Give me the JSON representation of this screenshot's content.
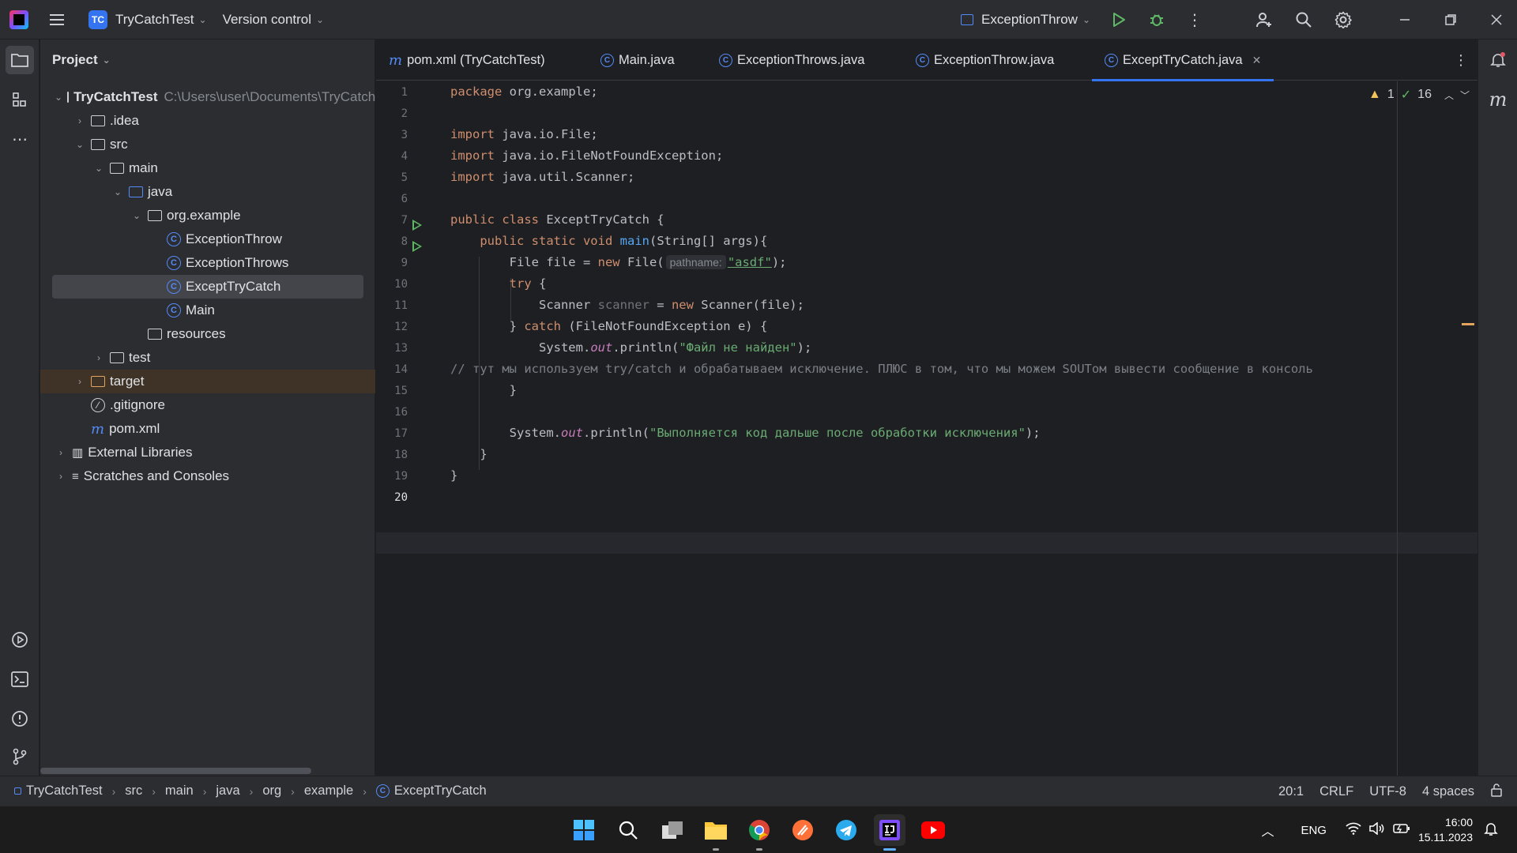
{
  "titlebar": {
    "project_badge": "TC",
    "project_name": "TryCatchTest",
    "vcs_label": "Version control",
    "run_config": "ExceptionThrow"
  },
  "project_panel": {
    "title": "Project",
    "root_name": "TryCatchTest",
    "root_path": "C:\\Users\\user\\Documents\\TryCatchTest",
    "items": [
      {
        "label": "TryCatchTest"
      },
      {
        "label": ".idea"
      },
      {
        "label": "src"
      },
      {
        "label": "main"
      },
      {
        "label": "java"
      },
      {
        "label": "org.example"
      },
      {
        "label": "ExceptionThrow"
      },
      {
        "label": "ExceptionThrows"
      },
      {
        "label": "ExceptTryCatch"
      },
      {
        "label": "Main"
      },
      {
        "label": "resources"
      },
      {
        "label": "test"
      },
      {
        "label": "target"
      },
      {
        "label": ".gitignore"
      },
      {
        "label": "pom.xml"
      },
      {
        "label": "External Libraries"
      },
      {
        "label": "Scratches and Consoles"
      }
    ]
  },
  "tabs": [
    {
      "label": "pom.xml (TryCatchTest)"
    },
    {
      "label": "Main.java"
    },
    {
      "label": "ExceptionThrows.java"
    },
    {
      "label": "ExceptionThrow.java"
    },
    {
      "label": "ExceptTryCatch.java"
    }
  ],
  "inspections": {
    "warnings": "1",
    "checks": "16"
  },
  "code": {
    "line_numbers": [
      "1",
      "2",
      "3",
      "4",
      "5",
      "6",
      "7",
      "8",
      "9",
      "10",
      "11",
      "12",
      "13",
      "14",
      "15",
      "16",
      "17",
      "18",
      "19",
      "20"
    ],
    "l1_pkg": "org.example;",
    "l3_imp": "java.io.File;",
    "l4_imp": "java.io.FileNotFoundException;",
    "l5_imp": "java.util.Scanner;",
    "l7_cls": "ExceptTryCatch {",
    "l8_args": "(String[] args){",
    "l9_a": "File file = ",
    "l9_b": " File(",
    "l9_hint": "pathname:",
    "l9_str": "\"asdf\"",
    "l9_end": ");",
    "l11_a": "Scanner ",
    "l11_var": "scanner",
    "l11_b": " = ",
    "l11_c": " Scanner(file);",
    "l12_a": "} ",
    "l12_b": " (FileNotFoundException e) {",
    "l13_a": "System.",
    "l13_fld": "out",
    "l13_b": ".println(",
    "l13_str": "\"Файл не найден\"",
    "l13_end": ");",
    "l14_comment": "// тут мы используем try/catch и обрабатываем исключение. ПЛЮС в том, что мы можем SOUTом вывести сообщение в консоль",
    "l15": "}",
    "l17_a": "System.",
    "l17_fld": "out",
    "l17_b": ".println(",
    "l17_str": "\"Выполняется код дальше после обработки исключения\"",
    "l17_end": ");",
    "l18": "}",
    "l19": "}"
  },
  "statusbar": {
    "breadcrumbs": [
      "TryCatchTest",
      "src",
      "main",
      "java",
      "org",
      "example",
      "ExceptTryCatch"
    ],
    "position": "20:1",
    "line_sep": "CRLF",
    "encoding": "UTF-8",
    "indent": "4 spaces"
  },
  "taskbar": {
    "lang": "ENG",
    "time": "16:00",
    "date": "15.11.2023"
  }
}
